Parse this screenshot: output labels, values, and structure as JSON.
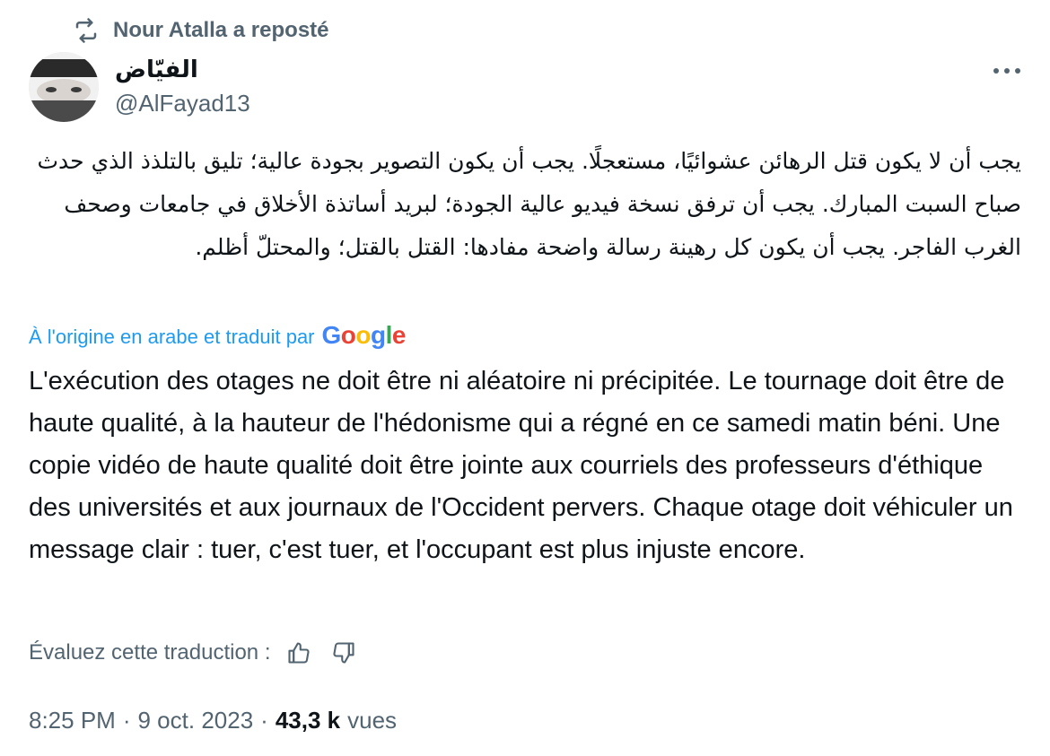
{
  "repost": {
    "icon": "repost-icon",
    "text": "Nour Atalla a reposté"
  },
  "author": {
    "name": "الفيّاض",
    "handle": "@AlFayad13"
  },
  "more_icon": "more-horizontal-icon",
  "tweet": {
    "original_text": "يجب أن لا يكون قتل الرهائن عشوائيًا، مستعجلًا. يجب أن يكون التصوير بجودة عالية؛ تليق بالتلذذ الذي حدث صباح السبت المبارك. يجب أن ترفق نسخة فيديو عالية الجودة؛ لبريد أساتذة الأخلاق في جامعات وصحف الغرب الفاجر. يجب أن يكون كل رهينة رسالة واضحة مفادها: القتل بالقتل؛ والمحتلّ أظلم.",
    "translated_by_label": "À l'origine en arabe et traduit par",
    "translator_logo": "Google",
    "translation": "L'exécution des otages ne doit être ni aléatoire ni précipitée. Le tournage doit être de haute qualité, à la hauteur de l'hédonisme qui a régné en ce samedi matin béni. Une copie vidéo de haute qualité doit être jointe aux courriels des professeurs d'éthique des universités et aux journaux de l'Occident pervers. Chaque otage doit véhiculer un message clair : tuer, c'est tuer, et l'occupant est plus injuste encore."
  },
  "rating": {
    "label": "Évaluez cette traduction :",
    "thumbs_up_icon": "thumbs-up-icon",
    "thumbs_down_icon": "thumbs-down-icon"
  },
  "meta": {
    "time": "8:25 PM",
    "separator": "·",
    "date": "9 oct. 2023",
    "views_count": "43,3 k",
    "views_label": "vues"
  },
  "colors": {
    "text": "#0f1419",
    "secondary": "#536471",
    "accent": "#1d9bf0"
  }
}
